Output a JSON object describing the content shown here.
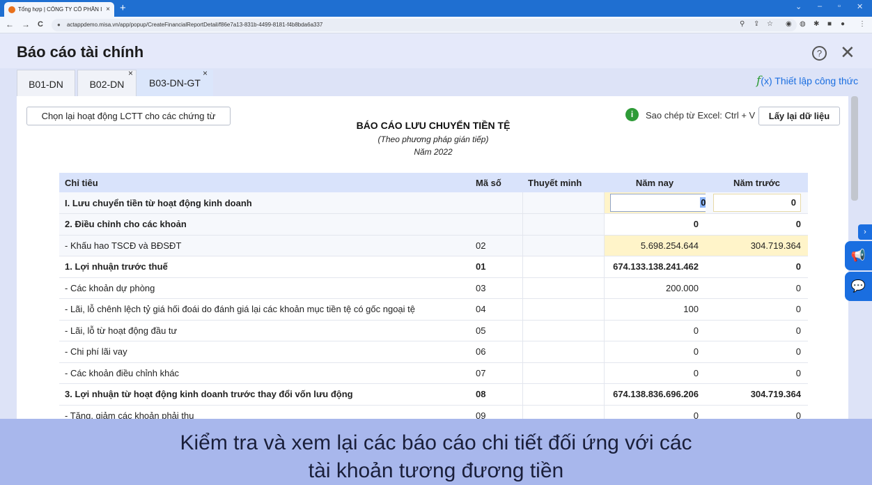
{
  "browser": {
    "tab_title": "Tổng hợp | CÔNG TY CỔ PHẦN I",
    "tab_close": "×",
    "new_tab": "+",
    "url": "actappdemo.misa.vn/app/popup/CreateFinancialReportDetail/f86e7a13-831b-4499-8181-f4b8bda6a337",
    "back": "←",
    "forward": "→",
    "reload": "C",
    "chevron": "⌄",
    "minimize": "–",
    "maximize": "▫",
    "close": "✕"
  },
  "app": {
    "title": "Báo cáo tài chính",
    "help": "?",
    "close": "✕",
    "tabs": [
      {
        "label": "B01-DN",
        "close": ""
      },
      {
        "label": "B02-DN",
        "close": "×"
      },
      {
        "label": "B03-DN-GT",
        "close": "×"
      }
    ],
    "formula_icon": "f",
    "formula_x": "(x)",
    "formula_label": "Thiết lập công thức"
  },
  "toolbar": {
    "rechoose_label": "Chọn lại hoạt động LCTT cho các chứng từ",
    "info_icon": "i",
    "copy_hint": "Sao chép từ Excel: Ctrl + V",
    "reload_label": "Lấy lại dữ liệu"
  },
  "report": {
    "title": "BÁO CÁO LƯU CHUYỂN TIỀN TỆ",
    "subtitle": "(Theo phương pháp gián tiếp)",
    "year": "Năm 2022"
  },
  "table": {
    "headers": [
      "Chỉ tiêu",
      "Mã số",
      "Thuyết minh",
      "Năm nay",
      "Năm trước"
    ],
    "rows": [
      {
        "label": "I. Lưu chuyển tiền từ hoạt động kinh doanh",
        "code": "",
        "note": "",
        "this_year": "0",
        "last_year": "0"
      },
      {
        "label": "2. Điều chỉnh cho các khoản",
        "code": "",
        "note": "",
        "this_year": "0",
        "last_year": "0"
      },
      {
        "label": "- Khấu hao TSCĐ và BĐSĐT",
        "code": "02",
        "note": "",
        "this_year": "5.698.254.644",
        "last_year": "304.719.364"
      },
      {
        "label": "1. Lợi nhuận trước thuế",
        "code": "01",
        "note": "",
        "this_year": "674.133.138.241.462",
        "last_year": "0"
      },
      {
        "label": "- Các khoản dự phòng",
        "code": "03",
        "note": "",
        "this_year": "200.000",
        "last_year": "0"
      },
      {
        "label": "- Lãi, lỗ chênh lệch tỷ giá hối đoái do đánh giá lại các khoản mục tiền tệ có gốc ngoại tệ",
        "code": "04",
        "note": "",
        "this_year": "100",
        "last_year": "0"
      },
      {
        "label": "- Lãi, lỗ từ hoạt động đầu tư",
        "code": "05",
        "note": "",
        "this_year": "0",
        "last_year": "0"
      },
      {
        "label": "- Chi phí lãi vay",
        "code": "06",
        "note": "",
        "this_year": "0",
        "last_year": "0"
      },
      {
        "label": "- Các khoản điều chỉnh khác",
        "code": "07",
        "note": "",
        "this_year": "0",
        "last_year": "0"
      },
      {
        "label": "3. Lợi nhuận từ hoạt động kinh doanh trước thay đổi vốn lưu động",
        "code": "08",
        "note": "",
        "this_year": "674.138.836.696.206",
        "last_year": "304.719.364"
      },
      {
        "label": "- Tăng, giảm các khoản phải thu",
        "code": "09",
        "note": "",
        "this_year": "0",
        "last_year": "0"
      }
    ]
  },
  "side": {
    "arrow": "›",
    "announce_icon": "📢",
    "chat_icon": "💬"
  },
  "caption": {
    "line1": "Kiểm tra và xem lại các báo cáo chi tiết đối ứng với các",
    "line2": "tài khoản tương đương tiền"
  }
}
